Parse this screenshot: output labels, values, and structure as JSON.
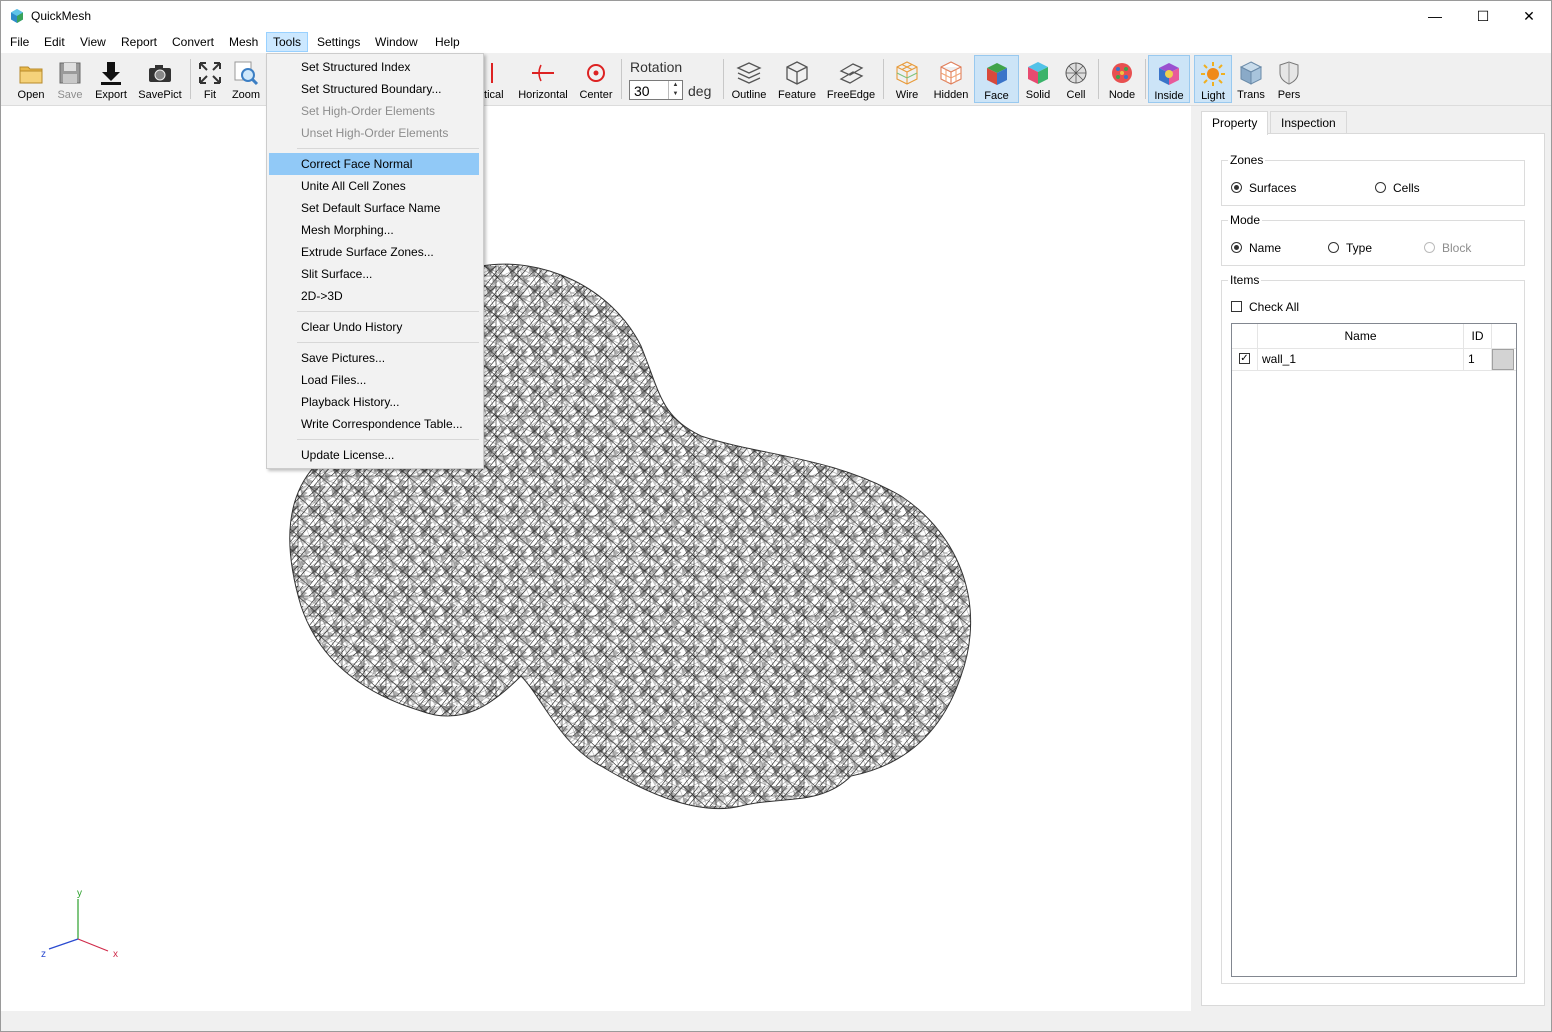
{
  "app": {
    "title": "QuickMesh",
    "minimize": "—",
    "maximize": "☐",
    "close": "✕"
  },
  "menubar": [
    {
      "label": "File"
    },
    {
      "label": "Edit"
    },
    {
      "label": "View"
    },
    {
      "label": "Report"
    },
    {
      "label": "Convert"
    },
    {
      "label": "Mesh"
    },
    {
      "label": "Tools"
    },
    {
      "label": "Settings"
    },
    {
      "label": "Window"
    },
    {
      "label": "Help"
    }
  ],
  "toolbar": {
    "open": "Open",
    "save": "Save",
    "export": "Export",
    "savepict": "SavePict",
    "fit": "Fit",
    "zoom": "Zoom",
    "vertical": "rtical",
    "horizontal": "Horizontal",
    "center": "Center",
    "rotation_label": "Rotation",
    "rotation_value": "30",
    "rotation_unit": "deg",
    "outline": "Outline",
    "feature": "Feature",
    "freeedge": "FreeEdge",
    "wire": "Wire",
    "hidden": "Hidden",
    "face": "Face",
    "solid": "Solid",
    "cell": "Cell",
    "node": "Node",
    "inside": "Inside",
    "light": "Light",
    "trans": "Trans",
    "pers": "Pers"
  },
  "tools_menu": {
    "items": [
      {
        "label": "Set Structured Index",
        "enabled": true
      },
      {
        "label": "Set Structured Boundary...",
        "enabled": true
      },
      {
        "label": "Set High-Order Elements",
        "enabled": false
      },
      {
        "label": "Unset High-Order Elements",
        "enabled": false
      },
      {
        "label": "Correct Face Normal",
        "enabled": true,
        "highlighted": true
      },
      {
        "label": "Unite All Cell Zones",
        "enabled": true
      },
      {
        "label": "Set Default Surface Name",
        "enabled": true
      },
      {
        "label": "Mesh Morphing...",
        "enabled": true
      },
      {
        "label": "Extrude Surface Zones...",
        "enabled": true
      },
      {
        "label": "Slit Surface...",
        "enabled": true
      },
      {
        "label": "2D->3D",
        "enabled": true
      },
      {
        "label": "Clear Undo History",
        "enabled": true
      },
      {
        "label": "Save Pictures...",
        "enabled": true
      },
      {
        "label": "Load Files...",
        "enabled": true
      },
      {
        "label": "Playback History...",
        "enabled": true
      },
      {
        "label": "Write Correspondence Table...",
        "enabled": true
      },
      {
        "label": "Update License...",
        "enabled": true
      }
    ]
  },
  "axes": {
    "x": "x",
    "y": "y",
    "z": "z"
  },
  "panel": {
    "tabs": [
      "Property",
      "Inspection"
    ],
    "zones": {
      "title": "Zones",
      "options": [
        "Surfaces",
        "Cells"
      ],
      "selected": "Surfaces"
    },
    "mode": {
      "title": "Mode",
      "options": [
        "Name",
        "Type",
        "Block"
      ],
      "selected": "Name"
    },
    "items": {
      "title": "Items",
      "check_all": "Check All",
      "columns": [
        "Name",
        "ID"
      ],
      "rows": [
        {
          "checked": true,
          "name": "wall_1",
          "id": "1"
        }
      ]
    }
  },
  "colors": {
    "accent": "#91c9f7",
    "menu_active": "#cce8ff",
    "pressed": "#cce4f7"
  }
}
